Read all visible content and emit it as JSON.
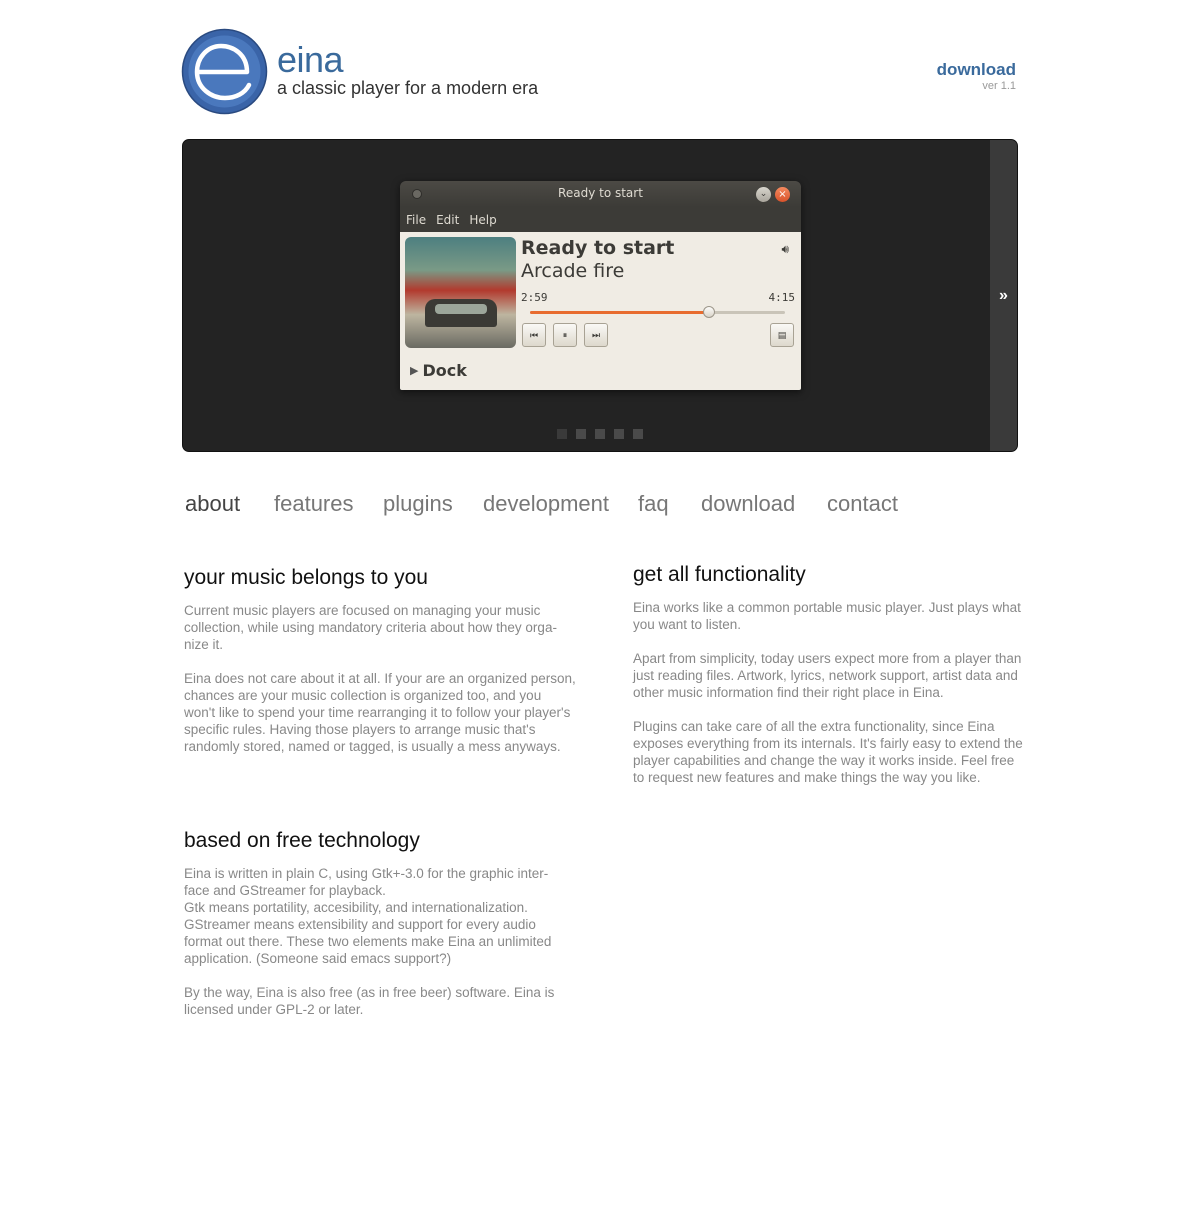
{
  "header": {
    "brand_name": "eina",
    "tagline": "a classic player for a modern era",
    "download_label": "download",
    "version": "ver 1.1"
  },
  "player": {
    "window_title": "Ready to start",
    "menu": [
      "File",
      "Edit",
      "Help"
    ],
    "song_title": "Ready to start",
    "artist": "Arcade fire",
    "time_current": "2:59",
    "time_total": "4:15",
    "progress": 0.7,
    "dock_label": "Dock",
    "accent_color": "#e86c2f"
  },
  "showcase": {
    "next_label": "»",
    "slides_count": 5,
    "active_slide": 0
  },
  "nav": {
    "items": [
      "about",
      "features",
      "plugins",
      "development",
      "faq",
      "download",
      "contact"
    ],
    "current": "about"
  },
  "sections": {
    "music": {
      "title": "your music belongs to you",
      "p1": "Current music players are focused on managing your music collection, while using mandatory criteria about how they orga- nize it.",
      "p2": "Eina does not care about it at all. If your are an organized person, chances are your music collection is organized too, and you won't like to spend your time rearranging it to follow your player's specific rules. Having those players to arrange music that's randomly stored, named or tagged, is usually a mess anyways."
    },
    "func": {
      "title": "get all functionality",
      "p1": "Eina works like a common portable music player. Just plays what you want to listen.",
      "p2": "Apart from simplicity, today users expect more from a player than just reading files. Artwork, lyrics, network support, artist data and other music information find their right place in Eina.",
      "p3": "Plugins can take care of all the extra functionality, since Eina exposes everything from its internals. It's fairly easy to extend the player capabilities and change the way it works inside. Feel free to request new features and make things the way you like."
    },
    "free": {
      "title": "based on free technology",
      "p1": "Eina is written in plain C, using Gtk+-3.0 for the graphic inter- face and GStreamer for playback.",
      "p2": "Gtk means portatility, accesibility, and internationalization.",
      "p3": "GStreamer means extensibility and support for every audio format out there. These two elements make Eina an unlimited application. (Someone said emacs support?)",
      "p4": "By the way, Eina is also free (as in free beer) software. Eina is licensed under GPL-2 or later."
    }
  }
}
